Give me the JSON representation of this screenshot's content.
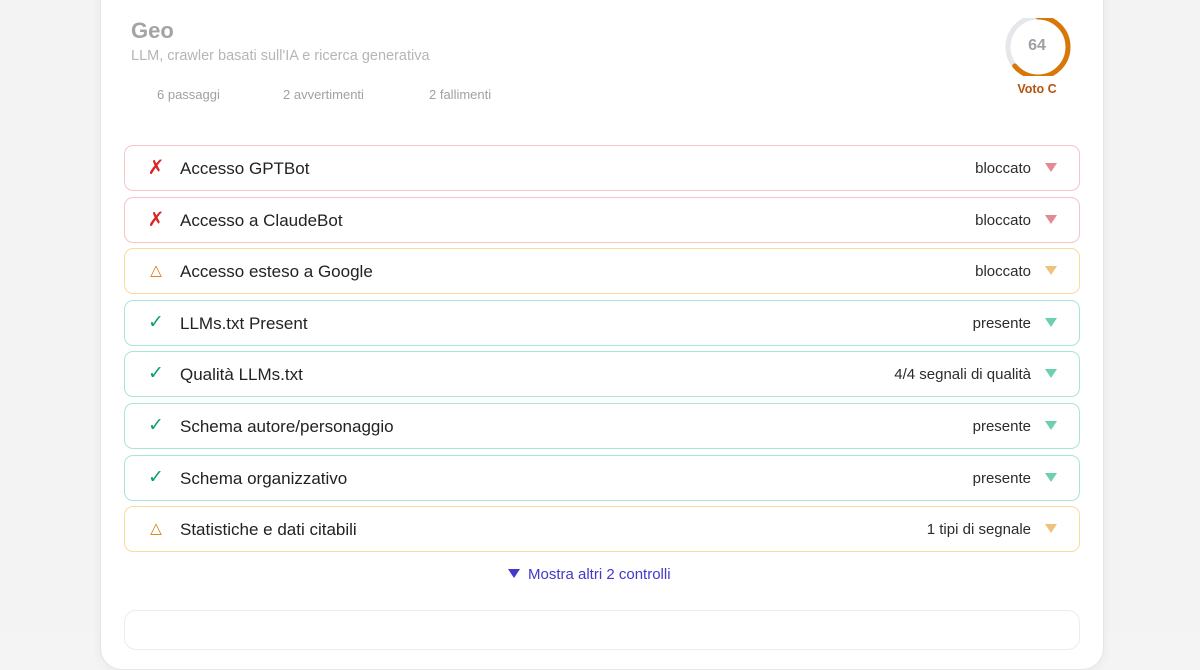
{
  "section": {
    "title": "Geo",
    "subtitle": "LLM, crawler basati sull'IA e ricerca generativa",
    "stats": {
      "passed": "6 passaggi",
      "warnings": "2 avvertimenti",
      "failures": "2 fallimenti"
    },
    "score": {
      "value": "64",
      "fraction": 0.64,
      "grade": "Voto C",
      "accent_color": "#d97706",
      "track_color": "#e5e7eb"
    }
  },
  "checks": [
    {
      "status": "fail",
      "icon": "cross-icon",
      "symbol": "✗",
      "label": "Accesso GPTBot",
      "value": "bloccato"
    },
    {
      "status": "fail",
      "icon": "cross-icon",
      "symbol": "✗",
      "label": "Accesso a ClaudeBot",
      "value": "bloccato"
    },
    {
      "status": "warn",
      "icon": "warning-triangle-icon",
      "symbol": "△",
      "label": "Accesso esteso a Google",
      "value": "bloccato"
    },
    {
      "status": "pass",
      "icon": "check-icon",
      "symbol": "✓",
      "label": "LLMs.txt Present",
      "value": "presente"
    },
    {
      "status": "pass",
      "icon": "check-icon",
      "symbol": "✓",
      "label": "Qualità LLMs.txt",
      "value": "4/4 segnali di qualità"
    },
    {
      "status": "pass",
      "icon": "check-icon",
      "symbol": "✓",
      "label": "Schema autore/personaggio",
      "value": "presente"
    },
    {
      "status": "pass",
      "icon": "check-icon",
      "symbol": "✓",
      "label": "Schema organizzativo",
      "value": "presente"
    },
    {
      "status": "warn",
      "icon": "warning-triangle-icon",
      "symbol": "△",
      "label": "Statistiche e dati citabili",
      "value": "1 tipi di segnale"
    }
  ],
  "show_more": {
    "label": "Mostra altri 2 controlli",
    "icon": "triangle-down-icon"
  },
  "colors": {
    "fail": "#dc2626",
    "warn": "#d97706",
    "pass": "#0f9f6e",
    "link": "#4338ca"
  }
}
